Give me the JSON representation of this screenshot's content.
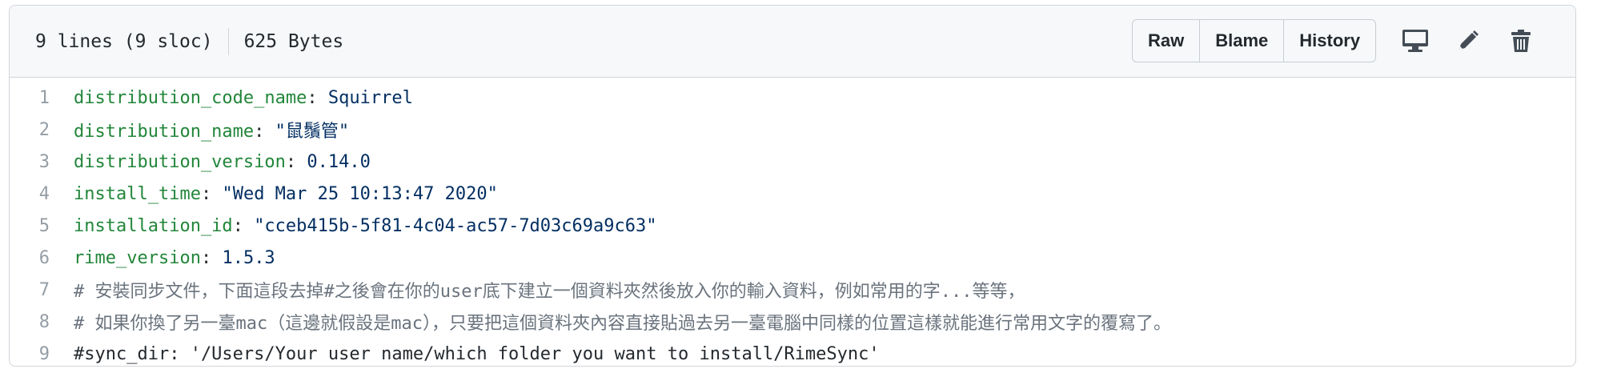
{
  "header": {
    "lines_info": "9 lines (9 sloc)",
    "size_info": "625 Bytes",
    "buttons": {
      "raw": "Raw",
      "blame": "Blame",
      "history": "History"
    },
    "icons": [
      "desktop-icon",
      "pencil-icon",
      "trash-icon"
    ]
  },
  "code": {
    "lines": [
      {
        "num": "1",
        "key": "distribution_code_name",
        "sep": ": ",
        "value": "Squirrel"
      },
      {
        "num": "2",
        "key": "distribution_name",
        "sep": ": ",
        "value": "\"鼠鬚管\""
      },
      {
        "num": "3",
        "key": "distribution_version",
        "sep": ": ",
        "value": "0.14.0"
      },
      {
        "num": "4",
        "key": "install_time",
        "sep": ": ",
        "value": "\"Wed Mar 25 10:13:47 2020\""
      },
      {
        "num": "5",
        "key": "installation_id",
        "sep": ": ",
        "value": "\"cceb415b-5f81-4c04-ac57-7d03c69a9c63\""
      },
      {
        "num": "6",
        "key": "rime_version",
        "sep": ": ",
        "value": "1.5.3"
      },
      {
        "num": "7",
        "comment": "# 安裝同步文件，下面這段去掉#之後會在你的user底下建立一個資料夾然後放入你的輸入資料，例如常用的字...等等，"
      },
      {
        "num": "8",
        "comment": "# 如果你換了另一臺mac（這邊就假設是mac），只要把這個資料夾內容直接貼過去另一臺電腦中同樣的位置這樣就能進行常用文字的覆寫了。"
      },
      {
        "num": "9",
        "comment": "#sync_dir: '/Users/Your user name/which folder you want to install/RimeSync'"
      }
    ]
  },
  "colors": {
    "key": "#22863a",
    "value": "#032f62",
    "comment": "#6a737d",
    "line_number": "#959da5",
    "header_bg": "#f6f8fa",
    "border": "#d1d5da"
  }
}
